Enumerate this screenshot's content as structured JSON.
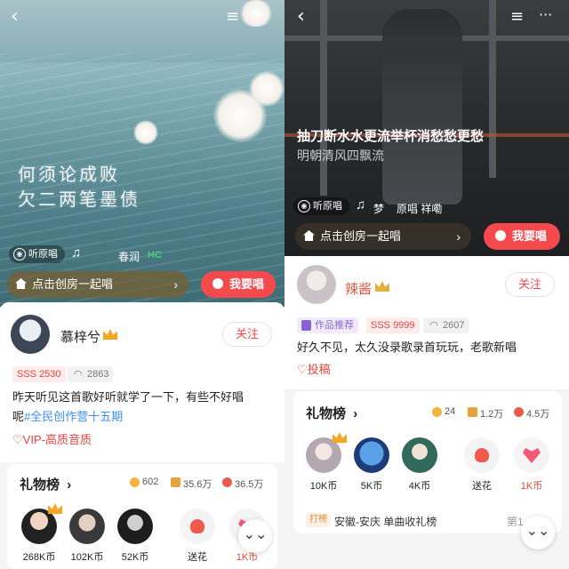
{
  "left": {
    "lyrics": [
      "何须论成败",
      "欠二两笔墨债"
    ],
    "listen_original": "听原唱",
    "singer_name": "春润",
    "hc_badge": "HC",
    "room_button": "点击创房一起唱",
    "sing_button": "我要唱",
    "user": {
      "name": "慕梓兮",
      "follow": "关注"
    },
    "tags": {
      "sss": "SSS 2530",
      "listens": "2863"
    },
    "description_lines": [
      "昨天听见这首歌好听就学了一下，有些不好唱",
      "呢"
    ],
    "topic": "#全民创作营十五期",
    "vip": "VIP-高质音质",
    "gifts": {
      "title": "礼物榜",
      "stats": [
        "602",
        "35.6万",
        "36.5万"
      ],
      "ranks": [
        "268K币",
        "102K币",
        "52K币"
      ],
      "gift_label": "送花",
      "gift_label_2": "1K币"
    }
  },
  "right": {
    "lyric_main": "抽刀断水水更流举杯消愁愁更愁",
    "lyric_sub": "明朝清风四飘流",
    "listen_original": "听原唱",
    "meta_left": "梦",
    "meta_right": "原唱 祥嘞",
    "room_button": "点击创房一起唱",
    "sing_button": "我要唱",
    "user": {
      "name": "辣酱",
      "follow": "关注"
    },
    "tags": {
      "recommend": "作品推荐",
      "sss": "SSS 9999",
      "listens": "2607"
    },
    "description": "好久不见，太久没录歌录首玩玩，老歌新唱",
    "contribute": "投稿",
    "gifts": {
      "title": "礼物榜",
      "stats": [
        "24",
        "1.2万",
        "4.5万"
      ],
      "ranks": [
        "10K币",
        "5K币",
        "4K币"
      ],
      "gift_label": "送花",
      "gift_label_2": "1K币",
      "rank_tag": "打榜",
      "rank_text": "安徽-安庆 单曲收礼榜",
      "rank_pos": "第1"
    }
  },
  "icons": {
    "back": "‹",
    "playlist": "≡",
    "more": "···",
    "scroll_down": "⌄⌄",
    "chevron": "›",
    "headphones": "◠"
  }
}
